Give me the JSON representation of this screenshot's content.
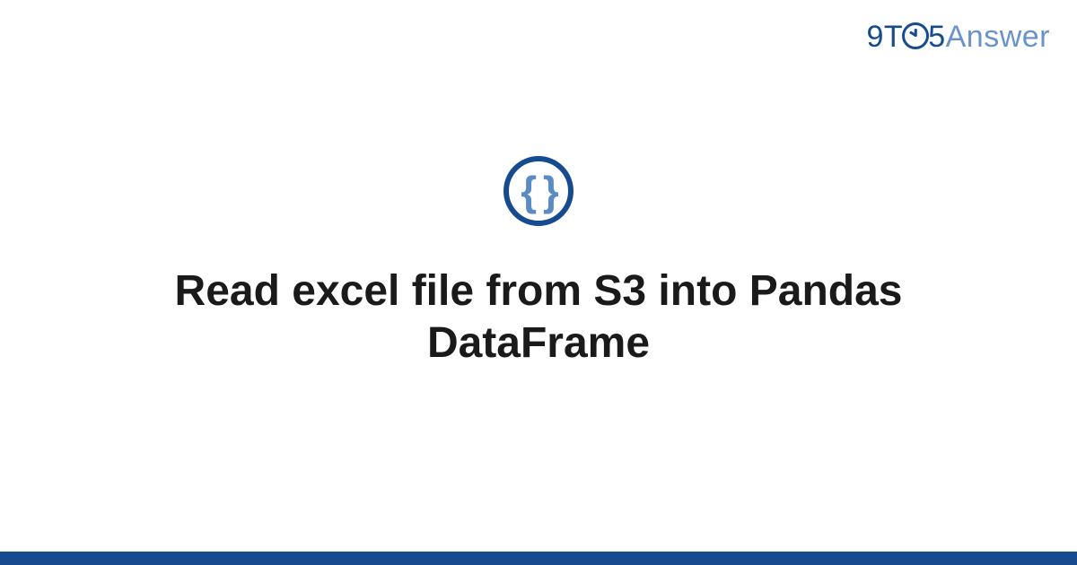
{
  "logo": {
    "prefix": "9T",
    "middle": "5",
    "suffix": "Answer"
  },
  "icon": {
    "braces": "{ }"
  },
  "title": "Read excel file from S3 into Pandas DataFrame"
}
